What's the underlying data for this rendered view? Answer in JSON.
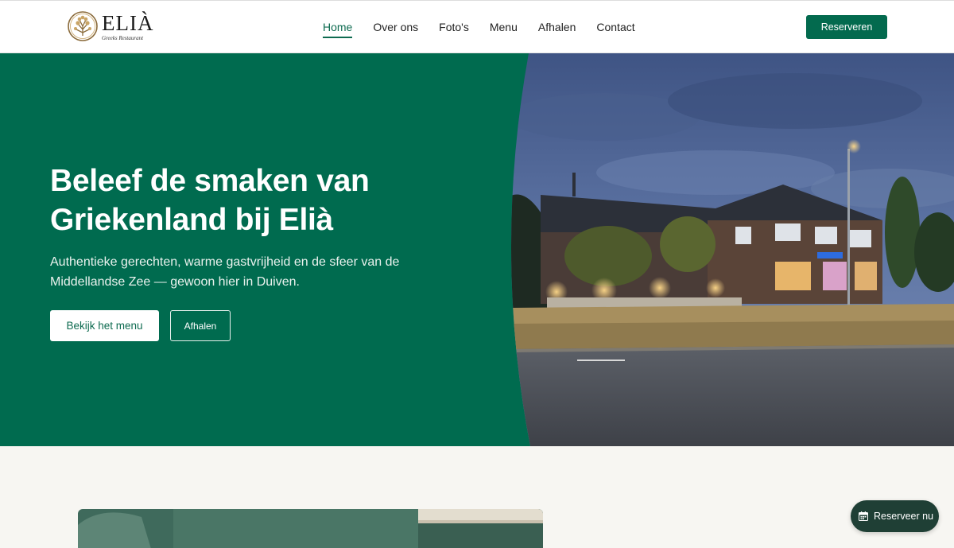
{
  "brand": {
    "name": "ELIÀ",
    "tagline": "Greeks Restaurant"
  },
  "nav": {
    "items": [
      {
        "label": "Home",
        "active": true
      },
      {
        "label": "Over ons",
        "active": false
      },
      {
        "label": "Foto's",
        "active": false
      },
      {
        "label": "Menu",
        "active": false
      },
      {
        "label": "Afhalen",
        "active": false
      },
      {
        "label": "Contact",
        "active": false
      }
    ],
    "cta_label": "Reserveren"
  },
  "hero": {
    "title": "Beleef de smaken van Griekenland bij Elià",
    "subtitle": "Authentieke gerechten, warme gastvrijheid en de sfeer van de Middellandse Zee — gewoon hier in Duiven.",
    "primary_button": "Bekijk het menu",
    "secondary_button": "Afhalen",
    "image_icon": "restaurant-building-photo"
  },
  "fab": {
    "label": "Reserveer nu",
    "icon": "calendar-icon"
  },
  "colors": {
    "brand_green": "#006b4f",
    "button_green": "#036a4e",
    "fab_dark": "#1f3f35",
    "background": "#f7f6f2"
  }
}
